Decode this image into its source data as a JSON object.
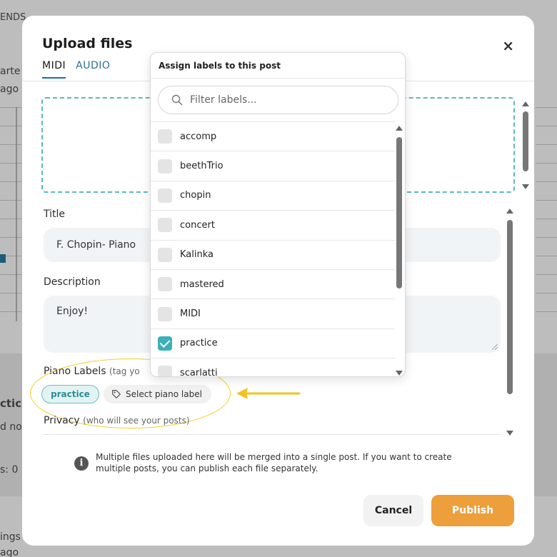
{
  "background": {
    "fragments": [
      "ENDS",
      "arte",
      "ago",
      "ctic",
      "d no",
      "s: 0",
      "ings",
      "ago"
    ]
  },
  "modal": {
    "title": "Upload files",
    "close_glyph": "×",
    "tabs": [
      {
        "label": "MIDI",
        "active": true
      },
      {
        "label": "AUDIO",
        "active": false
      }
    ],
    "fields": {
      "title_label": "Title",
      "title_value": "F. Chopin- Piano",
      "description_label": "Description",
      "description_value": "Enjoy!",
      "piano_labels_label": "Piano Labels",
      "piano_labels_hint": "(tag yo",
      "privacy_label": "Privacy",
      "privacy_hint": "(who will see your posts)"
    },
    "selected_labels": [
      "practice"
    ],
    "select_label_button": "Select piano label",
    "info_text": "Multiple files uploaded here will be merged into a single post. If you want to create multiple posts, you can publish each file separately.",
    "cancel_label": "Cancel",
    "publish_label": "Publish"
  },
  "label_dropdown": {
    "header": "Assign labels to this post",
    "search_placeholder": "Filter labels...",
    "items": [
      {
        "label": "accomp",
        "checked": false
      },
      {
        "label": "beethTrio",
        "checked": false
      },
      {
        "label": "chopin",
        "checked": false
      },
      {
        "label": "concert",
        "checked": false
      },
      {
        "label": "Kalinka",
        "checked": false
      },
      {
        "label": "mastered",
        "checked": false
      },
      {
        "label": "MIDI",
        "checked": false
      },
      {
        "label": "practice",
        "checked": true
      },
      {
        "label": "scarlatti",
        "checked": false
      }
    ]
  },
  "colors": {
    "accent": "#3bb0b8",
    "publish": "#ec9f3a",
    "highlight": "#f2cc1e"
  }
}
